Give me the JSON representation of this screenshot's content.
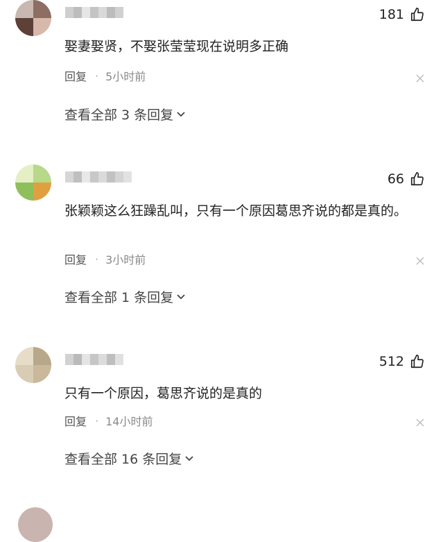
{
  "comments": [
    {
      "likes": "181",
      "text": "娶妻娶贤，不娶张莹莹现在说明多正确",
      "reply_label": "回复",
      "separator": "·",
      "time": "5小时前",
      "view_replies": "查看全部 3 条回复",
      "avatar_colors": [
        "#b9a8a2",
        "#8d6e63",
        "#5d4037",
        "#d7b8aa"
      ]
    },
    {
      "likes": "66",
      "text": "张颖颖这么狂躁乱叫，只有一个原因葛思齐说的都是真的。",
      "reply_label": "回复",
      "separator": "·",
      "time": "3小时前",
      "view_replies": "查看全部 1 条回复",
      "avatar_colors": [
        "#d6e6a8",
        "#8fbf5a",
        "#e0a040",
        "#b8d88a"
      ]
    },
    {
      "likes": "512",
      "text": "只有一个原因，葛思齐说的是真的",
      "reply_label": "回复",
      "separator": "·",
      "time": "14小时前",
      "view_replies": "查看全部 16 条回复",
      "avatar_colors": [
        "#d8ccb4",
        "#b8a88a",
        "#e6dcc8",
        "#c9b99a"
      ]
    }
  ],
  "icons": {
    "like": "thumbs-up-icon",
    "close": "close-icon",
    "expand": "chevron-down-icon"
  }
}
